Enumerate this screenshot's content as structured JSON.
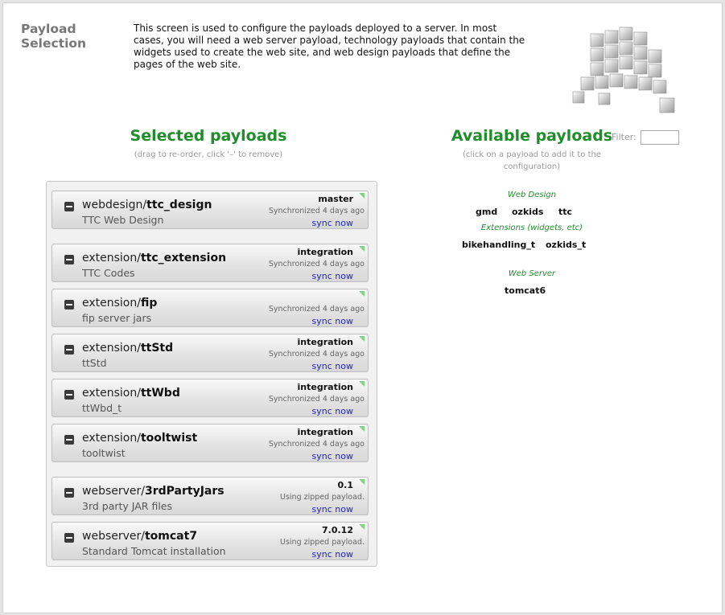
{
  "page": {
    "title": "Payload Selection",
    "intro": "This screen is used to configure the payloads deployed to a server. In most cases, you will need a web server payload, technology payloads that contain the widgets used to create the web site, and web design payloads that define the pages of the web site."
  },
  "selected": {
    "heading": "Selected payloads",
    "hint": "(drag to re-order, click '–' to remove)",
    "items": [
      {
        "prefix": "webdesign/",
        "name": "ttc_design",
        "desc": "TTC Web Design",
        "branch": "master",
        "status": "Synchronized 4 days ago",
        "sync": "sync now"
      },
      {
        "prefix": "extension/",
        "name": "ttc_extension",
        "desc": "TTC Codes",
        "branch": "integration",
        "status": "Synchronized 4 days ago",
        "sync": "sync now"
      },
      {
        "prefix": "extension/",
        "name": "fip",
        "desc": "fip server jars",
        "branch": "",
        "status": "Synchronized 4 days ago",
        "sync": "sync now"
      },
      {
        "prefix": "extension/",
        "name": "ttStd",
        "desc": "ttStd",
        "branch": "integration",
        "status": "Synchronized 4 days ago",
        "sync": "sync now"
      },
      {
        "prefix": "extension/",
        "name": "ttWbd",
        "desc": "ttWbd_t",
        "branch": "integration",
        "status": "Synchronized 4 days ago",
        "sync": "sync now"
      },
      {
        "prefix": "extension/",
        "name": "tooltwist",
        "desc": "tooltwist",
        "branch": "integration",
        "status": "Synchronized 4 days ago",
        "sync": "sync now"
      },
      {
        "prefix": "webserver/",
        "name": "3rdPartyJars",
        "desc": "3rd party JAR files",
        "branch": "0.1",
        "status": "Using zipped payload.",
        "sync": "sync now"
      },
      {
        "prefix": "webserver/",
        "name": "tomcat7",
        "desc": "Standard Tomcat installation",
        "branch": "7.0.12",
        "status": "Using zipped payload.",
        "sync": "sync now"
      }
    ]
  },
  "available": {
    "heading": "Available payloads",
    "hint_line1": "(click on a payload to add it to the",
    "hint_line2": "configuration)",
    "filter_label": "Filter:",
    "filter_value": "",
    "groups": [
      {
        "label": "Web Design",
        "items": [
          "gmd",
          "ozkids",
          "ttc"
        ]
      },
      {
        "label": "Extensions (widgets, etc)",
        "items": [
          "bikehandling_t",
          "ozkids_t"
        ]
      },
      {
        "label": "Web Server",
        "items": [
          "tomcat6"
        ]
      }
    ]
  },
  "icons": {
    "remove": "minus-square-icon",
    "branch": "branch-triangle-icon",
    "logo": "cubes-logo-icon"
  },
  "colors": {
    "heading_green": "#1e8e2a",
    "link_blue": "#2222cc",
    "branch_green": "#7fd486"
  }
}
